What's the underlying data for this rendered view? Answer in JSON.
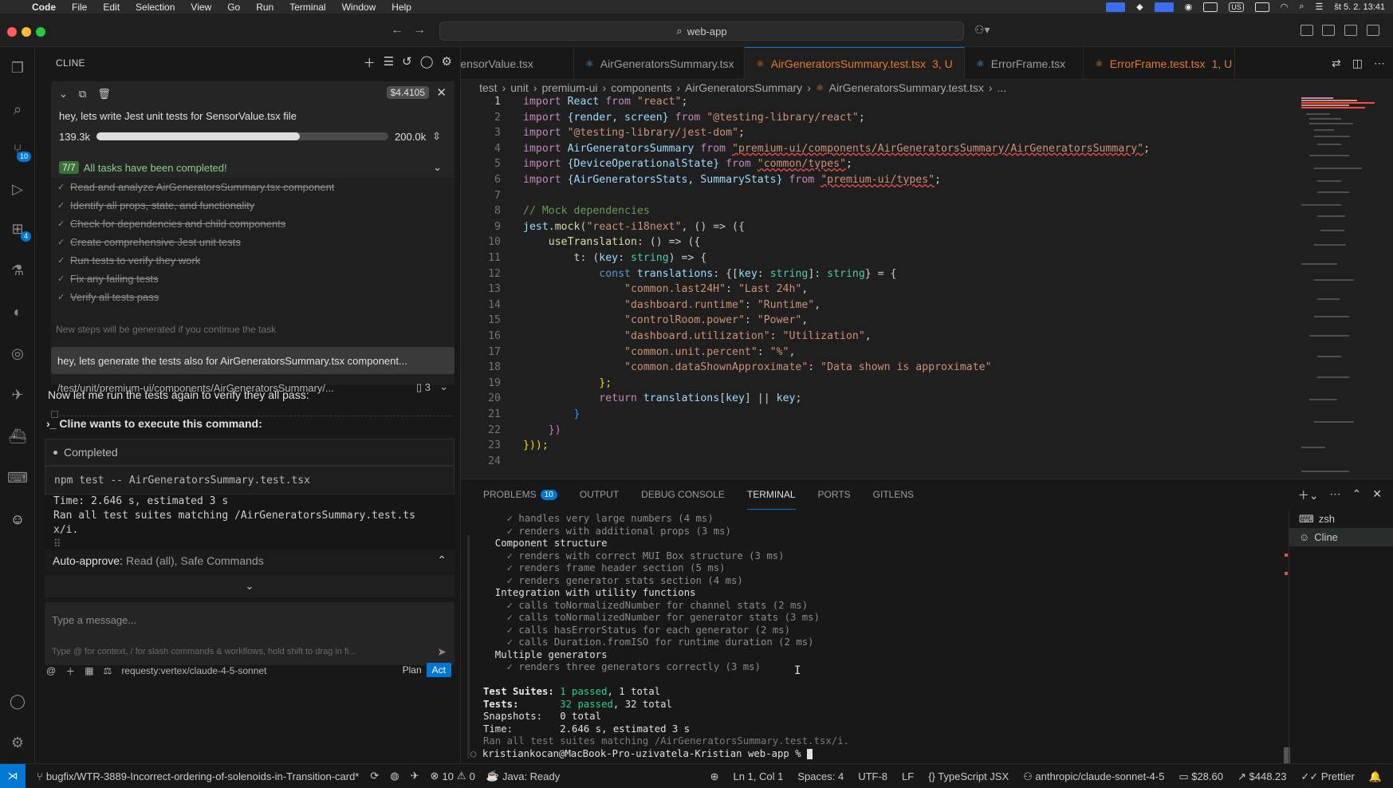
{
  "menubar": {
    "app": "Code",
    "items": [
      "File",
      "Edit",
      "Selection",
      "View",
      "Go",
      "Run",
      "Terminal",
      "Window",
      "Help"
    ],
    "datetime": "št 5. 2.  13:41",
    "input_source": "US"
  },
  "titlebar": {
    "search": "web-app"
  },
  "activity": {
    "scm_badge": "10",
    "ext_badge": "4"
  },
  "cline": {
    "title": "CLINE",
    "cost": "$4.4105",
    "task": "hey, lets write Jest unit tests for SensorValue.tsx file",
    "ctx_used": "139.3k",
    "ctx_max": "200.0k",
    "ctx_fraction": 0.697,
    "tasks_count": "7/7",
    "tasks_done": "All tasks have been completed!",
    "todos": [
      "Read and analyze AirGeneratorsSummary.tsx component",
      "Identify all props, state, and functionality",
      "Check for dependencies and child components",
      "Create comprehensive Jest unit tests",
      "Run tests to verify they work",
      "Fix any failing tests",
      "Verify all tests pass"
    ],
    "new_steps": "New steps will be generated if you continue the task",
    "user_message": "hey, lets generate the tests also for AirGeneratorsSummary.tsx component...",
    "file_path": "/test/unit/premium-ui/components/AirGeneratorsSummary/...",
    "file_count": "3",
    "now_text": "Now let me run the tests again to verify they all pass:",
    "exec_header": "Cline wants to execute this command:",
    "completed": "Completed",
    "command": "npm test -- AirGeneratorsSummary.test.tsx",
    "output": [
      "Time:        2.646 s, estimated 3 s",
      "Ran all test suites matching /AirGeneratorsSummary.test.ts",
      "x/i."
    ],
    "auto_approve_label": "Auto-approve:",
    "auto_approve_value": "Read (all), Safe Commands",
    "input_placeholder": "Type a message...",
    "input_hint": "Type @ for context, / for slash commands & workflows, hold shift to drag in fi...",
    "model": "requesty:vertex/claude-4-5-sonnet",
    "plan": "Plan",
    "act": "Act"
  },
  "tabs": [
    {
      "label": "SensorValue.tsx",
      "state": ""
    },
    {
      "label": "AirGeneratorsSummary.tsx",
      "state": ""
    },
    {
      "label": "AirGeneratorsSummary.test.tsx",
      "state": "3, U",
      "active": true
    },
    {
      "label": "ErrorFrame.tsx",
      "state": ""
    },
    {
      "label": "ErrorFrame.test.tsx",
      "state": "1, U"
    }
  ],
  "breadcrumb": [
    "test",
    "unit",
    "premium-ui",
    "components",
    "AirGeneratorsSummary",
    "AirGeneratorsSummary.test.tsx",
    "..."
  ],
  "code_lines": [
    "1",
    "2",
    "3",
    "4",
    "5",
    "6",
    "7",
    "8",
    "9",
    "10",
    "11",
    "12",
    "13",
    "14",
    "15",
    "16",
    "17",
    "18",
    "19",
    "20",
    "21",
    "22",
    "23",
    "24"
  ],
  "code": {
    "l1a": "import",
    "l1b": " React ",
    "l1c": "from",
    "l1d": " \"react\"",
    "l1e": ";",
    "l2a": "import",
    "l2b": " {render, screen} ",
    "l2c": "from",
    "l2d": " \"@testing-library/react\"",
    "l2e": ";",
    "l3a": "import",
    "l3d": " \"@testing-library/jest-dom\"",
    "l3e": ";",
    "l4a": "import",
    "l4b": " AirGeneratorsSummary ",
    "l4c": "from",
    "l4d": "\"premium-ui/components/AirGeneratorsSummary/AirGeneratorsSummary\"",
    "l4e": ";",
    "l5a": "import",
    "l5b": " {DeviceOperationalState} ",
    "l5c": "from",
    "l5d": "\"common/types\"",
    "l5e": ";",
    "l6a": "import",
    "l6b": " {AirGeneratorsStats, SummaryStats} ",
    "l6c": "from",
    "l6d": "\"premium-ui/types\"",
    "l6e": ";",
    "l8": "// Mock dependencies",
    "l9a": "jest",
    "l9b": ".",
    "l9c": "mock",
    "l9d": "(",
    "l9e": "\"react-i18next\"",
    "l9f": ", () => ({",
    "l10a": "    useTranslation",
    "l10b": ": () => ({",
    "l11a": "        t",
    "l11b": ": (",
    "l11c": "key",
    "l11d": ": ",
    "l11e": "string",
    "l11f": ") => {",
    "l12a": "            const",
    "l12b": " translations",
    "l12c": ": {[",
    "l12d": "key",
    "l12e": ": ",
    "l12f": "string",
    "l12g": "]: ",
    "l12h": "string",
    "l12i": "} = {",
    "l13a": "                \"common.last24H\"",
    "l13b": ": ",
    "l13c": "\"Last 24h\"",
    "l13d": ",",
    "l14a": "                \"dashboard.runtime\"",
    "l14b": ": ",
    "l14c": "\"Runtime\"",
    "l14d": ",",
    "l15a": "                \"controlRoom.power\"",
    "l15b": ": ",
    "l15c": "\"Power\"",
    "l15d": ",",
    "l16a": "                \"dashboard.utilization\"",
    "l16b": ": ",
    "l16c": "\"Utilization\"",
    "l16d": ",",
    "l17a": "                \"common.unit.percent\"",
    "l17b": ": ",
    "l17c": "\"%\"",
    "l17d": ",",
    "l18a": "                \"common.dataShownApproximate\"",
    "l18b": ": ",
    "l18c": "\"Data shown is approximate\"",
    "l19": "            };",
    "l20a": "            return",
    "l20b": " translations",
    "l20c": "[",
    "l20d": "key",
    "l20e": "] || ",
    "l20f": "key",
    "l20g": ";",
    "l21": "        }",
    "l22": "    })",
    "l23": "}));"
  },
  "panel": {
    "tabs": [
      "PROBLEMS",
      "OUTPUT",
      "DEBUG CONSOLE",
      "TERMINAL",
      "PORTS",
      "GITLENS"
    ],
    "problems_badge": "10",
    "terminals": [
      "zsh",
      "Cline"
    ]
  },
  "terminal": {
    "t1": "    ✓ handles very large numbers (4 ms)",
    "t2": "    ✓ renders with additional props (3 ms)",
    "t3": "  Component structure",
    "t4": "    ✓ renders with correct MUI Box structure (3 ms)",
    "t5": "    ✓ renders frame header section (5 ms)",
    "t6": "    ✓ renders generator stats section (4 ms)",
    "t7": "  Integration with utility functions",
    "t8": "    ✓ calls toNormalizedNumber for channel stats (2 ms)",
    "t9": "    ✓ calls toNormalizedNumber for generator stats (3 ms)",
    "t10": "    ✓ calls hasErrorStatus for each generator (2 ms)",
    "t11": "    ✓ calls Duration.fromISO for runtime duration (2 ms)",
    "t12": "  Multiple generators",
    "t13": "    ✓ renders three generators correctly (3 ms)",
    "s1a": "Test Suites: ",
    "s1b": "1 passed",
    "s1c": ", 1 total",
    "s2a": "Tests:       ",
    "s2b": "32 passed",
    "s2c": ", 32 total",
    "s3": "Snapshots:   0 total",
    "s4": "Time:        2.646 s, estimated 3 s",
    "s5": "Ran all test suites matching /AirGeneratorsSummary.test.tsx/i.",
    "prompt": "kristiankocan@MacBook-Pro-uzivatela-Kristian web-app % "
  },
  "statusbar": {
    "branch": "bugfix/WTR-3889-Incorrect-ordering-of-solenoids-in-Transition-card*",
    "errors": "10",
    "warnings": "0",
    "java": "Java: Ready",
    "position": "Ln 1, Col 1",
    "spaces": "Spaces: 4",
    "encoding": "UTF-8",
    "eol": "LF",
    "language": "TypeScript JSX",
    "model": "anthropic/claude-sonnet-4-5",
    "cost1": "$28.60",
    "cost2": "$448.23",
    "formatter": "Prettier"
  }
}
